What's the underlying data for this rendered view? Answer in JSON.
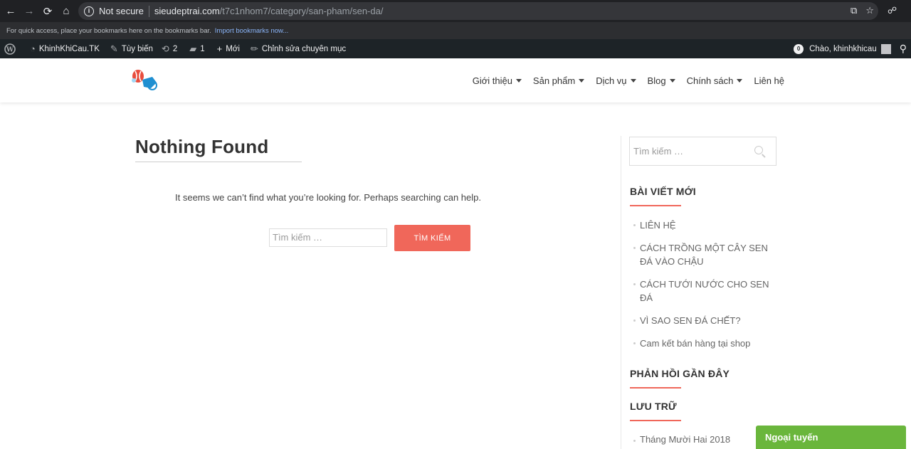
{
  "browser": {
    "security_label": "Not secure",
    "url_host": "sieudeptrai.com",
    "url_path": "/t7c1nhom7/category/san-pham/sen-da/",
    "bookmarks_hint": "For quick access, place your bookmarks here on the bookmarks bar.",
    "import_bookmarks": "Import bookmarks now..."
  },
  "admin_bar": {
    "site_name": "KhinhKhiCau.TK",
    "customize": "Tùy biến",
    "updates_count": "2",
    "comments_count": "1",
    "new_label": "Mới",
    "edit_category": "Chỉnh sửa chuyên mục",
    "notif_count": "0",
    "greeting": "Chào, khinhkhicau"
  },
  "nav": {
    "items": [
      "Giới thiệu",
      "Sản phẩm",
      "Dịch vụ",
      "Blog",
      "Chính sách",
      "Liên hệ"
    ]
  },
  "main": {
    "title": "Nothing Found",
    "message": "It seems we can’t find what you’re looking for. Perhaps searching can help.",
    "search_placeholder": "Tìm kiếm …",
    "search_button": "TÌM KIẾM"
  },
  "sidebar": {
    "search_placeholder": "Tìm kiếm …",
    "recent_posts_title": "BÀI VIẾT MỚI",
    "recent_posts": [
      "LIÊN HỆ",
      "CÁCH TRỒNG MỘT CÂY SEN ĐÁ VÀO CHẬU",
      "CÁCH TƯỚI NƯỚC CHO SEN ĐÁ",
      "VÌ SAO SEN ĐÁ CHẾT?",
      "Cam kết bán hàng tại shop"
    ],
    "recent_comments_title": "PHẢN HỒI GẦN ĐÂY",
    "archives_title": "LƯU TRỮ",
    "archives": [
      "Tháng Mười Hai 2018"
    ]
  },
  "chat": {
    "status": "Ngoại tuyến"
  },
  "colors": {
    "accent": "#f0675a",
    "chat_green": "#6ab63c",
    "admin_bar": "#1d2327"
  }
}
